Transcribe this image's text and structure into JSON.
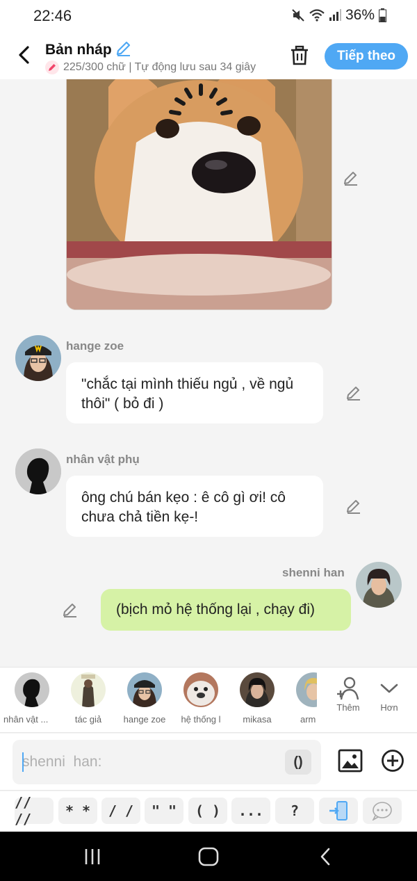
{
  "status_bar": {
    "time": "22:46",
    "battery_pct": "36%"
  },
  "header": {
    "title": "Bản nháp",
    "subtitle": "225/300 chữ | Tự động lưu sau 34 giây",
    "next_label": "Tiếp theo"
  },
  "messages": [
    {
      "type": "image",
      "description_icon": "corgi-photo"
    },
    {
      "sender": "hange zoe",
      "text": "\"chắc tại mình thiếu ngủ , về ngủ thôi\" ( bỏ đi )"
    },
    {
      "sender": "nhân vật phụ",
      "text": "ông chú bán kẹo : ê cô gì ơi!  cô chưa chả tiền kẹ-!"
    },
    {
      "sender": "shenni  han",
      "text": "(bịch mỏ hệ thống lại , chạy đi)",
      "mine": true
    }
  ],
  "characters": [
    {
      "label": "nhân vật ..."
    },
    {
      "label": "tác giả"
    },
    {
      "label": "hange zoe"
    },
    {
      "label": "hệ thống l"
    },
    {
      "label": "mikasa"
    },
    {
      "label": "arm"
    }
  ],
  "strip_actions": {
    "add_label": "Thêm",
    "more_label": "Hơn"
  },
  "input": {
    "placeholder": "shenni  han:",
    "paren_label": "()"
  },
  "symbols": [
    "// //",
    "* *",
    "/ /",
    "\" \"",
    "( )",
    "...",
    "?"
  ]
}
